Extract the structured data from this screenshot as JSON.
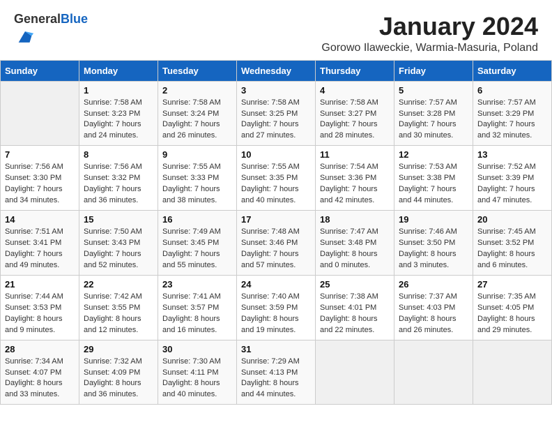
{
  "header": {
    "logo_general": "General",
    "logo_blue": "Blue",
    "month_title": "January 2024",
    "location": "Gorowo Ilaweckie, Warmia-Masuria, Poland"
  },
  "weekdays": [
    "Sunday",
    "Monday",
    "Tuesday",
    "Wednesday",
    "Thursday",
    "Friday",
    "Saturday"
  ],
  "weeks": [
    [
      {
        "day": "",
        "lines": []
      },
      {
        "day": "1",
        "lines": [
          "Sunrise: 7:58 AM",
          "Sunset: 3:23 PM",
          "Daylight: 7 hours",
          "and 24 minutes."
        ]
      },
      {
        "day": "2",
        "lines": [
          "Sunrise: 7:58 AM",
          "Sunset: 3:24 PM",
          "Daylight: 7 hours",
          "and 26 minutes."
        ]
      },
      {
        "day": "3",
        "lines": [
          "Sunrise: 7:58 AM",
          "Sunset: 3:25 PM",
          "Daylight: 7 hours",
          "and 27 minutes."
        ]
      },
      {
        "day": "4",
        "lines": [
          "Sunrise: 7:58 AM",
          "Sunset: 3:27 PM",
          "Daylight: 7 hours",
          "and 28 minutes."
        ]
      },
      {
        "day": "5",
        "lines": [
          "Sunrise: 7:57 AM",
          "Sunset: 3:28 PM",
          "Daylight: 7 hours",
          "and 30 minutes."
        ]
      },
      {
        "day": "6",
        "lines": [
          "Sunrise: 7:57 AM",
          "Sunset: 3:29 PM",
          "Daylight: 7 hours",
          "and 32 minutes."
        ]
      }
    ],
    [
      {
        "day": "7",
        "lines": [
          "Sunrise: 7:56 AM",
          "Sunset: 3:30 PM",
          "Daylight: 7 hours",
          "and 34 minutes."
        ]
      },
      {
        "day": "8",
        "lines": [
          "Sunrise: 7:56 AM",
          "Sunset: 3:32 PM",
          "Daylight: 7 hours",
          "and 36 minutes."
        ]
      },
      {
        "day": "9",
        "lines": [
          "Sunrise: 7:55 AM",
          "Sunset: 3:33 PM",
          "Daylight: 7 hours",
          "and 38 minutes."
        ]
      },
      {
        "day": "10",
        "lines": [
          "Sunrise: 7:55 AM",
          "Sunset: 3:35 PM",
          "Daylight: 7 hours",
          "and 40 minutes."
        ]
      },
      {
        "day": "11",
        "lines": [
          "Sunrise: 7:54 AM",
          "Sunset: 3:36 PM",
          "Daylight: 7 hours",
          "and 42 minutes."
        ]
      },
      {
        "day": "12",
        "lines": [
          "Sunrise: 7:53 AM",
          "Sunset: 3:38 PM",
          "Daylight: 7 hours",
          "and 44 minutes."
        ]
      },
      {
        "day": "13",
        "lines": [
          "Sunrise: 7:52 AM",
          "Sunset: 3:39 PM",
          "Daylight: 7 hours",
          "and 47 minutes."
        ]
      }
    ],
    [
      {
        "day": "14",
        "lines": [
          "Sunrise: 7:51 AM",
          "Sunset: 3:41 PM",
          "Daylight: 7 hours",
          "and 49 minutes."
        ]
      },
      {
        "day": "15",
        "lines": [
          "Sunrise: 7:50 AM",
          "Sunset: 3:43 PM",
          "Daylight: 7 hours",
          "and 52 minutes."
        ]
      },
      {
        "day": "16",
        "lines": [
          "Sunrise: 7:49 AM",
          "Sunset: 3:45 PM",
          "Daylight: 7 hours",
          "and 55 minutes."
        ]
      },
      {
        "day": "17",
        "lines": [
          "Sunrise: 7:48 AM",
          "Sunset: 3:46 PM",
          "Daylight: 7 hours",
          "and 57 minutes."
        ]
      },
      {
        "day": "18",
        "lines": [
          "Sunrise: 7:47 AM",
          "Sunset: 3:48 PM",
          "Daylight: 8 hours",
          "and 0 minutes."
        ]
      },
      {
        "day": "19",
        "lines": [
          "Sunrise: 7:46 AM",
          "Sunset: 3:50 PM",
          "Daylight: 8 hours",
          "and 3 minutes."
        ]
      },
      {
        "day": "20",
        "lines": [
          "Sunrise: 7:45 AM",
          "Sunset: 3:52 PM",
          "Daylight: 8 hours",
          "and 6 minutes."
        ]
      }
    ],
    [
      {
        "day": "21",
        "lines": [
          "Sunrise: 7:44 AM",
          "Sunset: 3:53 PM",
          "Daylight: 8 hours",
          "and 9 minutes."
        ]
      },
      {
        "day": "22",
        "lines": [
          "Sunrise: 7:42 AM",
          "Sunset: 3:55 PM",
          "Daylight: 8 hours",
          "and 12 minutes."
        ]
      },
      {
        "day": "23",
        "lines": [
          "Sunrise: 7:41 AM",
          "Sunset: 3:57 PM",
          "Daylight: 8 hours",
          "and 16 minutes."
        ]
      },
      {
        "day": "24",
        "lines": [
          "Sunrise: 7:40 AM",
          "Sunset: 3:59 PM",
          "Daylight: 8 hours",
          "and 19 minutes."
        ]
      },
      {
        "day": "25",
        "lines": [
          "Sunrise: 7:38 AM",
          "Sunset: 4:01 PM",
          "Daylight: 8 hours",
          "and 22 minutes."
        ]
      },
      {
        "day": "26",
        "lines": [
          "Sunrise: 7:37 AM",
          "Sunset: 4:03 PM",
          "Daylight: 8 hours",
          "and 26 minutes."
        ]
      },
      {
        "day": "27",
        "lines": [
          "Sunrise: 7:35 AM",
          "Sunset: 4:05 PM",
          "Daylight: 8 hours",
          "and 29 minutes."
        ]
      }
    ],
    [
      {
        "day": "28",
        "lines": [
          "Sunrise: 7:34 AM",
          "Sunset: 4:07 PM",
          "Daylight: 8 hours",
          "and 33 minutes."
        ]
      },
      {
        "day": "29",
        "lines": [
          "Sunrise: 7:32 AM",
          "Sunset: 4:09 PM",
          "Daylight: 8 hours",
          "and 36 minutes."
        ]
      },
      {
        "day": "30",
        "lines": [
          "Sunrise: 7:30 AM",
          "Sunset: 4:11 PM",
          "Daylight: 8 hours",
          "and 40 minutes."
        ]
      },
      {
        "day": "31",
        "lines": [
          "Sunrise: 7:29 AM",
          "Sunset: 4:13 PM",
          "Daylight: 8 hours",
          "and 44 minutes."
        ]
      },
      {
        "day": "",
        "lines": []
      },
      {
        "day": "",
        "lines": []
      },
      {
        "day": "",
        "lines": []
      }
    ]
  ]
}
